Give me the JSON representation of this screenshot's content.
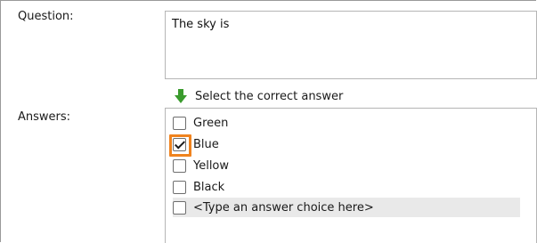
{
  "question": {
    "label": "Question:",
    "value": "The sky is"
  },
  "hint": {
    "icon": "green-arrow-down-icon",
    "text": "Select the correct answer"
  },
  "answers": {
    "label": "Answers:",
    "items": [
      {
        "text": "Green",
        "checked": false
      },
      {
        "text": "Blue",
        "checked": true
      },
      {
        "text": "Yellow",
        "checked": false
      },
      {
        "text": "Black",
        "checked": false
      },
      {
        "text": "<Type an answer choice here>",
        "checked": false
      }
    ]
  },
  "colors": {
    "highlight": "#f0831e",
    "arrow": "#3a9b2d"
  }
}
